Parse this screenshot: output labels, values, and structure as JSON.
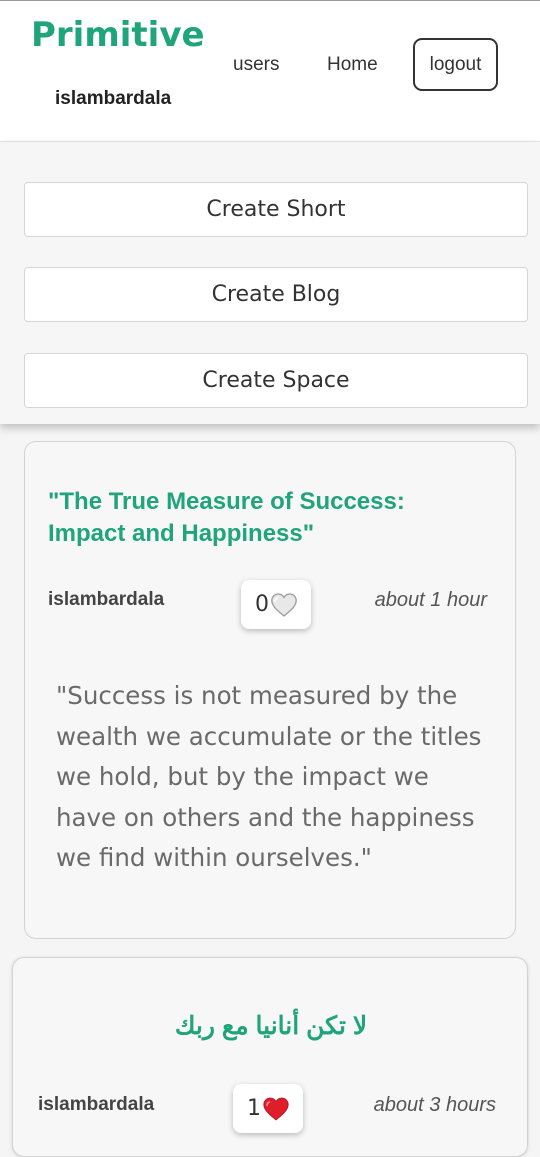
{
  "header": {
    "brand": "Primitive",
    "username": "islambardala",
    "nav": {
      "users": "users",
      "home": "Home",
      "logout": "logout"
    }
  },
  "create": {
    "short": "Create Short",
    "blog": "Create Blog",
    "space": "Create Space"
  },
  "posts": [
    {
      "title": "\"The True Measure of Success: Impact and Happiness\"",
      "author": "islambardala",
      "likes": "0",
      "liked": false,
      "time": "about 1 hour",
      "body": "\"Success is not measured by the wealth we accumulate or the titles we hold, but by the impact we have on others and the happiness we find within ourselves.\""
    },
    {
      "title": "لا تكن أنانيا مع ربك",
      "author": "islambardala",
      "likes": "1",
      "liked": true,
      "time": "about 3 hours"
    }
  ],
  "colors": {
    "brand": "#1fa47c",
    "heart_liked": "#e01e2b",
    "heart_unliked": "#e6e6e6"
  },
  "icons": {
    "unliked": "heart-outline-icon",
    "liked": "heart-filled-icon"
  }
}
